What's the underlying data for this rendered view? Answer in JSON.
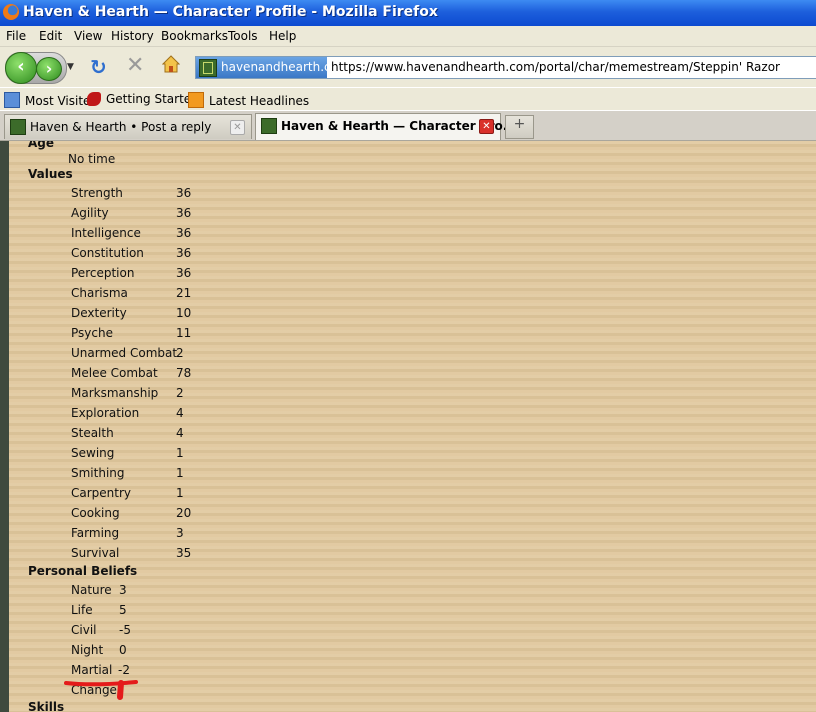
{
  "window": {
    "title": "Haven & Hearth — Character Profile - Mozilla Firefox"
  },
  "menu": [
    "File",
    "Edit",
    "View",
    "History",
    "Bookmarks",
    "Tools",
    "Help"
  ],
  "nav": {
    "site_badge": "havenandhearth.com",
    "url": "https://www.havenandhearth.com/portal/char/memestream/Steppin' Razor"
  },
  "bookmarks": [
    "Most Visited",
    "Getting Started",
    "Latest Headlines"
  ],
  "tabs": [
    {
      "label": "Haven & Hearth • Post a reply",
      "active": false
    },
    {
      "label": "Haven & Hearth — Character Pro...",
      "active": true
    }
  ],
  "profile": {
    "age_heading": "Age",
    "age_value": "No time",
    "values_heading": "Values",
    "values": [
      {
        "name": "Strength",
        "value": "36"
      },
      {
        "name": "Agility",
        "value": "36"
      },
      {
        "name": "Intelligence",
        "value": "36"
      },
      {
        "name": "Constitution",
        "value": "36"
      },
      {
        "name": "Perception",
        "value": "36"
      },
      {
        "name": "Charisma",
        "value": "21"
      },
      {
        "name": "Dexterity",
        "value": "10"
      },
      {
        "name": "Psyche",
        "value": "11"
      },
      {
        "name": "Unarmed Combat",
        "value": "2"
      },
      {
        "name": "Melee Combat",
        "value": "78"
      },
      {
        "name": "Marksmanship",
        "value": "2"
      },
      {
        "name": "Exploration",
        "value": "4"
      },
      {
        "name": "Stealth",
        "value": "4"
      },
      {
        "name": "Sewing",
        "value": "1"
      },
      {
        "name": "Smithing",
        "value": "1"
      },
      {
        "name": "Carpentry",
        "value": "1"
      },
      {
        "name": "Cooking",
        "value": "20"
      },
      {
        "name": "Farming",
        "value": "3"
      },
      {
        "name": "Survival",
        "value": "35"
      }
    ],
    "beliefs_heading": "Personal Beliefs",
    "beliefs": [
      {
        "name": "Nature",
        "value": "3"
      },
      {
        "name": "Life",
        "value": "5"
      },
      {
        "name": "Civil",
        "value": "-5"
      },
      {
        "name": "Night",
        "value": "0"
      },
      {
        "name": "Martial",
        "value": "-2"
      }
    ],
    "change_label": "Change",
    "skills_heading": "Skills"
  },
  "colors": {
    "annotation": "#e41b1b",
    "page_bg": "#e0c79c",
    "titlebar": "#1d5fdc"
  }
}
